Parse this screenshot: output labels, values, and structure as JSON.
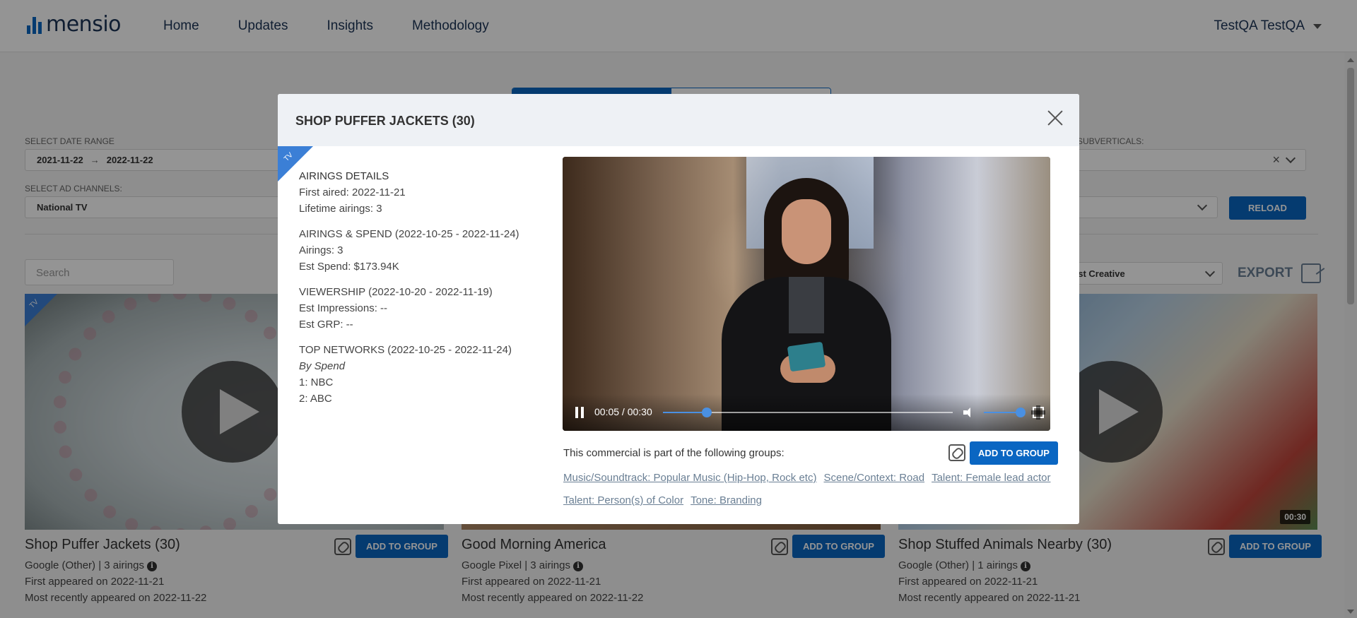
{
  "header": {
    "logo_text": "mensio",
    "nav": [
      "Home",
      "Updates",
      "Insights",
      "Methodology"
    ],
    "user": "TestQA TestQA"
  },
  "filters": {
    "date_range_label": "SELECT DATE RANGE",
    "date_start": "2021-11-22",
    "date_end": "2022-11-22",
    "ad_channels_label": "SELECT AD CHANNELS:",
    "ad_channels_value": "National TV",
    "subverticals_label": "SUBVERTICALS:",
    "reload_label": "RELOAD"
  },
  "toolbar": {
    "search_placeholder": "Search",
    "sort_value": "est Creative",
    "export_label": "EXPORT"
  },
  "cards": [
    {
      "title": "Shop Puffer Jackets (30)",
      "brand": "Google (Other) | 3 airings",
      "first": "First appeared on 2022-11-21",
      "recent": "Most recently appeared on 2022-11-22",
      "ribbon": "TV",
      "add_label": "ADD TO GROUP"
    },
    {
      "title": "Good Morning America",
      "brand": "Google Pixel | 3 airings",
      "first": "First appeared on 2022-11-21",
      "recent": "Most recently appeared on 2022-11-22",
      "add_label": "ADD TO GROUP"
    },
    {
      "title": "Shop Stuffed Animals Nearby (30)",
      "brand": "Google (Other) | 1 airings",
      "first": "First appeared on 2022-11-21",
      "recent": "Most recently appeared on 2022-11-21",
      "duration": "00:30",
      "add_label": "ADD TO GROUP"
    }
  ],
  "modal": {
    "title": "SHOP PUFFER JACKETS (30)",
    "ribbon": "TV",
    "airings_details": {
      "heading": "AIRINGS DETAILS",
      "first_aired": "First aired: 2022-11-21",
      "lifetime": "Lifetime airings: 3"
    },
    "airings_spend": {
      "heading": "AIRINGS & SPEND (2022-10-25 - 2022-11-24)",
      "airings": "Airings: 3",
      "spend": "Est Spend: $173.94K"
    },
    "viewership": {
      "heading": "VIEWERSHIP (2022-10-20 - 2022-11-19)",
      "impressions": "Est Impressions: --",
      "grp": "Est GRP: --"
    },
    "top_networks": {
      "heading": "TOP NETWORKS (2022-10-25 - 2022-11-24)",
      "by": "By Spend",
      "items": [
        "1: NBC",
        "2: ABC"
      ]
    },
    "video": {
      "time": "00:05 / 00:30",
      "progress": 0.15,
      "volume": 1.0
    },
    "groups_label": "This commercial is part of the following groups:",
    "add_label": "ADD TO GROUP",
    "tags": [
      "Music/Soundtrack: Popular Music (Hip-Hop, Rock etc)",
      "Scene/Context: Road",
      "Talent: Female lead actor",
      "Talent: Person(s) of Color",
      "Tone: Branding"
    ]
  },
  "colors": {
    "accent": "#0a66c2",
    "ribbon": "#3b7fd6",
    "link": "#6a7f94"
  }
}
